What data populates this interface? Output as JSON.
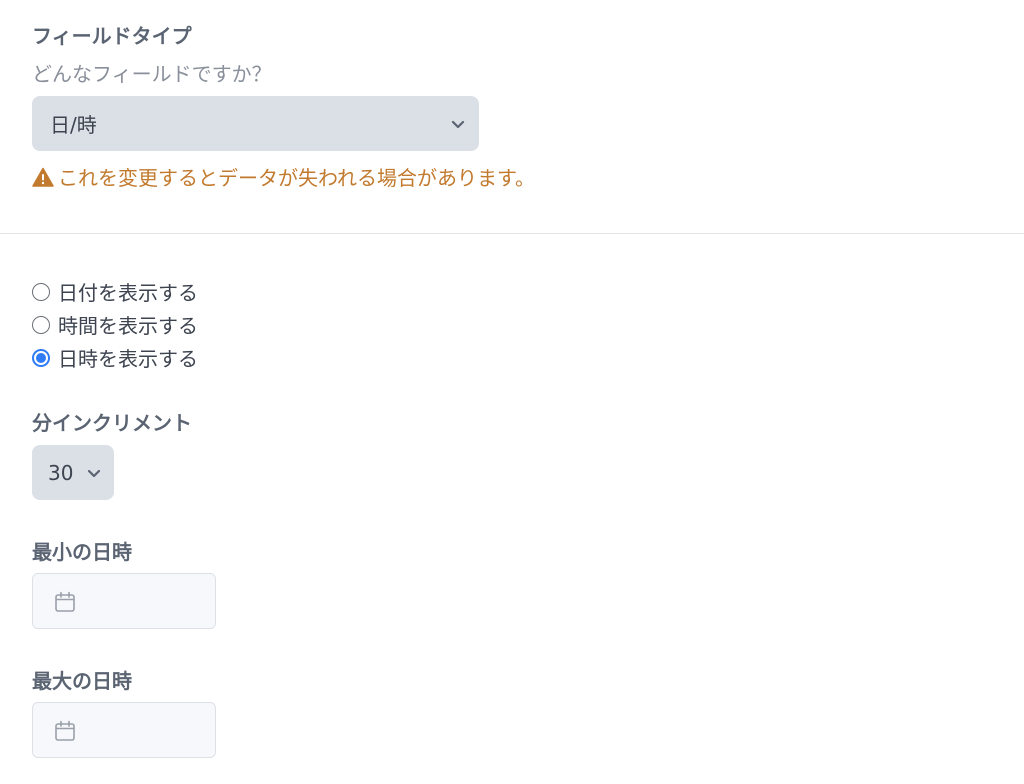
{
  "field_type": {
    "label": "フィールドタイプ",
    "question": "どんなフィールドですか？",
    "selected": "日/時",
    "warning": "これを変更するとデータが失われる場合があります。"
  },
  "display_options": [
    {
      "label": "日付を表示する",
      "checked": false
    },
    {
      "label": "時間を表示する",
      "checked": false
    },
    {
      "label": "日時を表示する",
      "checked": true
    }
  ],
  "minute_increment": {
    "label": "分インクリメント",
    "selected": "30"
  },
  "min_datetime": {
    "label": "最小の日時",
    "value": ""
  },
  "max_datetime": {
    "label": "最大の日時",
    "value": ""
  },
  "colors": {
    "warning": "#c27a2e",
    "radio_accent": "#2f7cf6",
    "select_bg": "#dbdfe6"
  },
  "icons": {
    "warning": "warning-triangle-icon",
    "chevron": "chevron-down-icon",
    "calendar": "calendar-icon"
  }
}
